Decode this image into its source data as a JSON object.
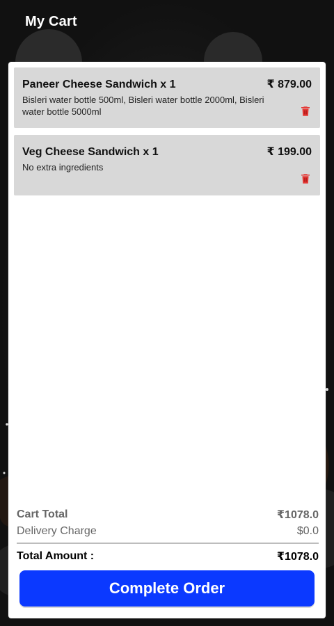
{
  "header": {
    "title": "My Cart"
  },
  "cart": {
    "items": [
      {
        "title": "Paneer Cheese Sandwich x 1",
        "price": "₹ 879.00",
        "description": "Bisleri water bottle 500ml, Bisleri water bottle 2000ml, Bisleri water bottle 5000ml"
      },
      {
        "title": "Veg Cheese Sandwich x 1",
        "price": "₹ 199.00",
        "description": "No extra ingredients"
      }
    ]
  },
  "totals": {
    "cart_total_label": "Cart Total",
    "cart_total_value": "₹1078.0",
    "delivery_label": "Delivery Charge",
    "delivery_value": "$0.0",
    "total_amount_label": "Total Amount :",
    "total_amount_value": "₹1078.0"
  },
  "actions": {
    "complete_order": "Complete Order"
  },
  "colors": {
    "accent": "#0b39ff",
    "delete": "#e53935",
    "item_bg": "#d8d8d8",
    "panel_bg": "#ffffff",
    "app_bg": "#121212"
  },
  "icons": {
    "delete": "trash-icon"
  }
}
